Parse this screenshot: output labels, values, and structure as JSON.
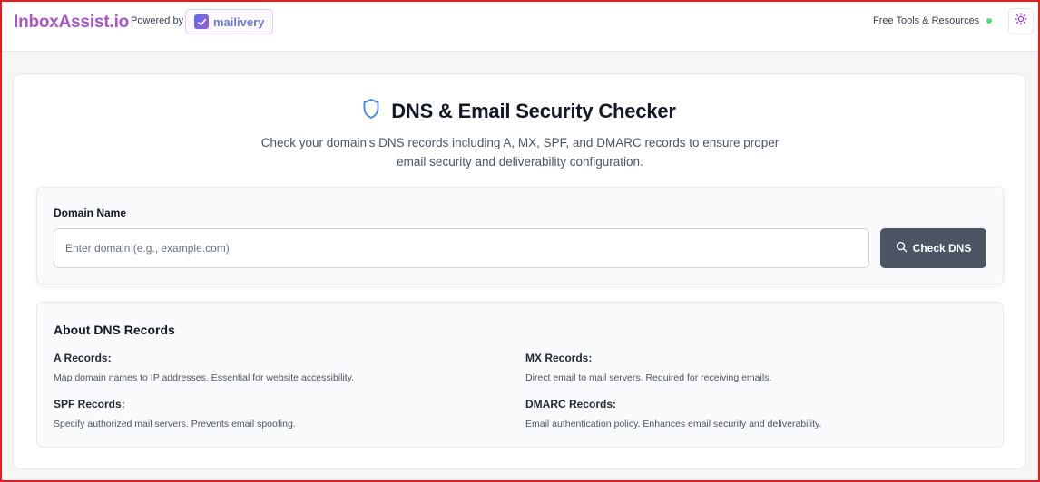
{
  "header": {
    "brand": "InboxAssist.io",
    "powered_by": "Powered by",
    "partner_name": "mailivery",
    "tools_link": "Free Tools & Resources",
    "status_color": "#4ade80",
    "theme_icon": "sun-icon"
  },
  "page": {
    "title": "DNS & Email Security Checker",
    "title_icon": "shield-icon",
    "subtitle": "Check your domain's DNS records including A, MX, SPF, and DMARC records to ensure proper email security and deliverability configuration."
  },
  "form": {
    "label": "Domain Name",
    "input_value": "",
    "placeholder": "Enter domain (e.g., example.com)",
    "button_label": "Check DNS",
    "button_icon": "search-icon"
  },
  "about": {
    "title": "About DNS Records",
    "records": [
      {
        "name": "A Records:",
        "description": "Map domain names to IP addresses. Essential for website accessibility."
      },
      {
        "name": "MX Records:",
        "description": "Direct email to mail servers. Required for receiving emails."
      },
      {
        "name": "SPF Records:",
        "description": "Specify authorized mail servers. Prevents email spoofing."
      },
      {
        "name": "DMARC Records:",
        "description": "Email authentication policy. Enhances email security and deliverability."
      }
    ]
  },
  "colors": {
    "brand": "#a855c8",
    "button": "#4b5563",
    "shield": "#3b82f6",
    "frame": "#e11d1d"
  }
}
